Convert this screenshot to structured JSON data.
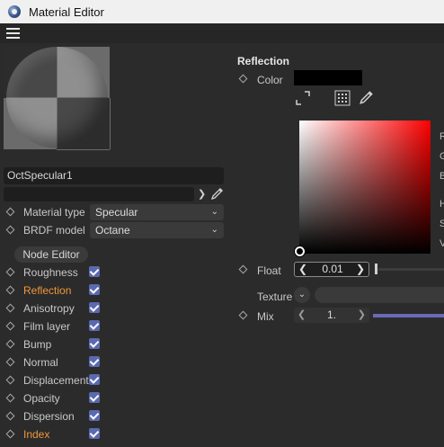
{
  "window": {
    "title": "Material Editor",
    "icon": "cinema4d-app-icon"
  },
  "menubar": {
    "icon": "hamburger-menu-icon"
  },
  "material": {
    "name": "OctSpecular1",
    "preset_value": ""
  },
  "properties": {
    "material_type": {
      "label": "Material type",
      "value": "Specular"
    },
    "brdf_model": {
      "label": "BRDF model",
      "value": "Octane"
    }
  },
  "node_editor_label": "Node Editor",
  "channels": [
    {
      "label": "Roughness",
      "checked": true,
      "active": false
    },
    {
      "label": "Reflection",
      "checked": true,
      "active": true
    },
    {
      "label": "Anisotropy",
      "checked": true,
      "active": false
    },
    {
      "label": "Film layer",
      "checked": true,
      "active": false
    },
    {
      "label": "Bump",
      "checked": true,
      "active": false
    },
    {
      "label": "Normal",
      "checked": true,
      "active": false
    },
    {
      "label": "Displacement",
      "checked": true,
      "active": false
    },
    {
      "label": "Opacity",
      "checked": true,
      "active": false
    },
    {
      "label": "Dispersion",
      "checked": true,
      "active": false
    },
    {
      "label": "Index",
      "checked": true,
      "active": true
    }
  ],
  "reflection": {
    "section_title": "Reflection",
    "color_label": "Color",
    "color_value": "#000000",
    "picker_channels": [
      "R",
      "G",
      "B",
      "H",
      "S",
      "V"
    ],
    "float_label": "Float",
    "float_value": "0.01",
    "float_level": 0.01,
    "texture_label": "Texture",
    "mix_label": "Mix",
    "mix_value": "1."
  },
  "colors": {
    "accent_orange": "#f0963c",
    "checkbox_blue": "#5a6ab0",
    "mix_slider": "#6a6ab8"
  }
}
